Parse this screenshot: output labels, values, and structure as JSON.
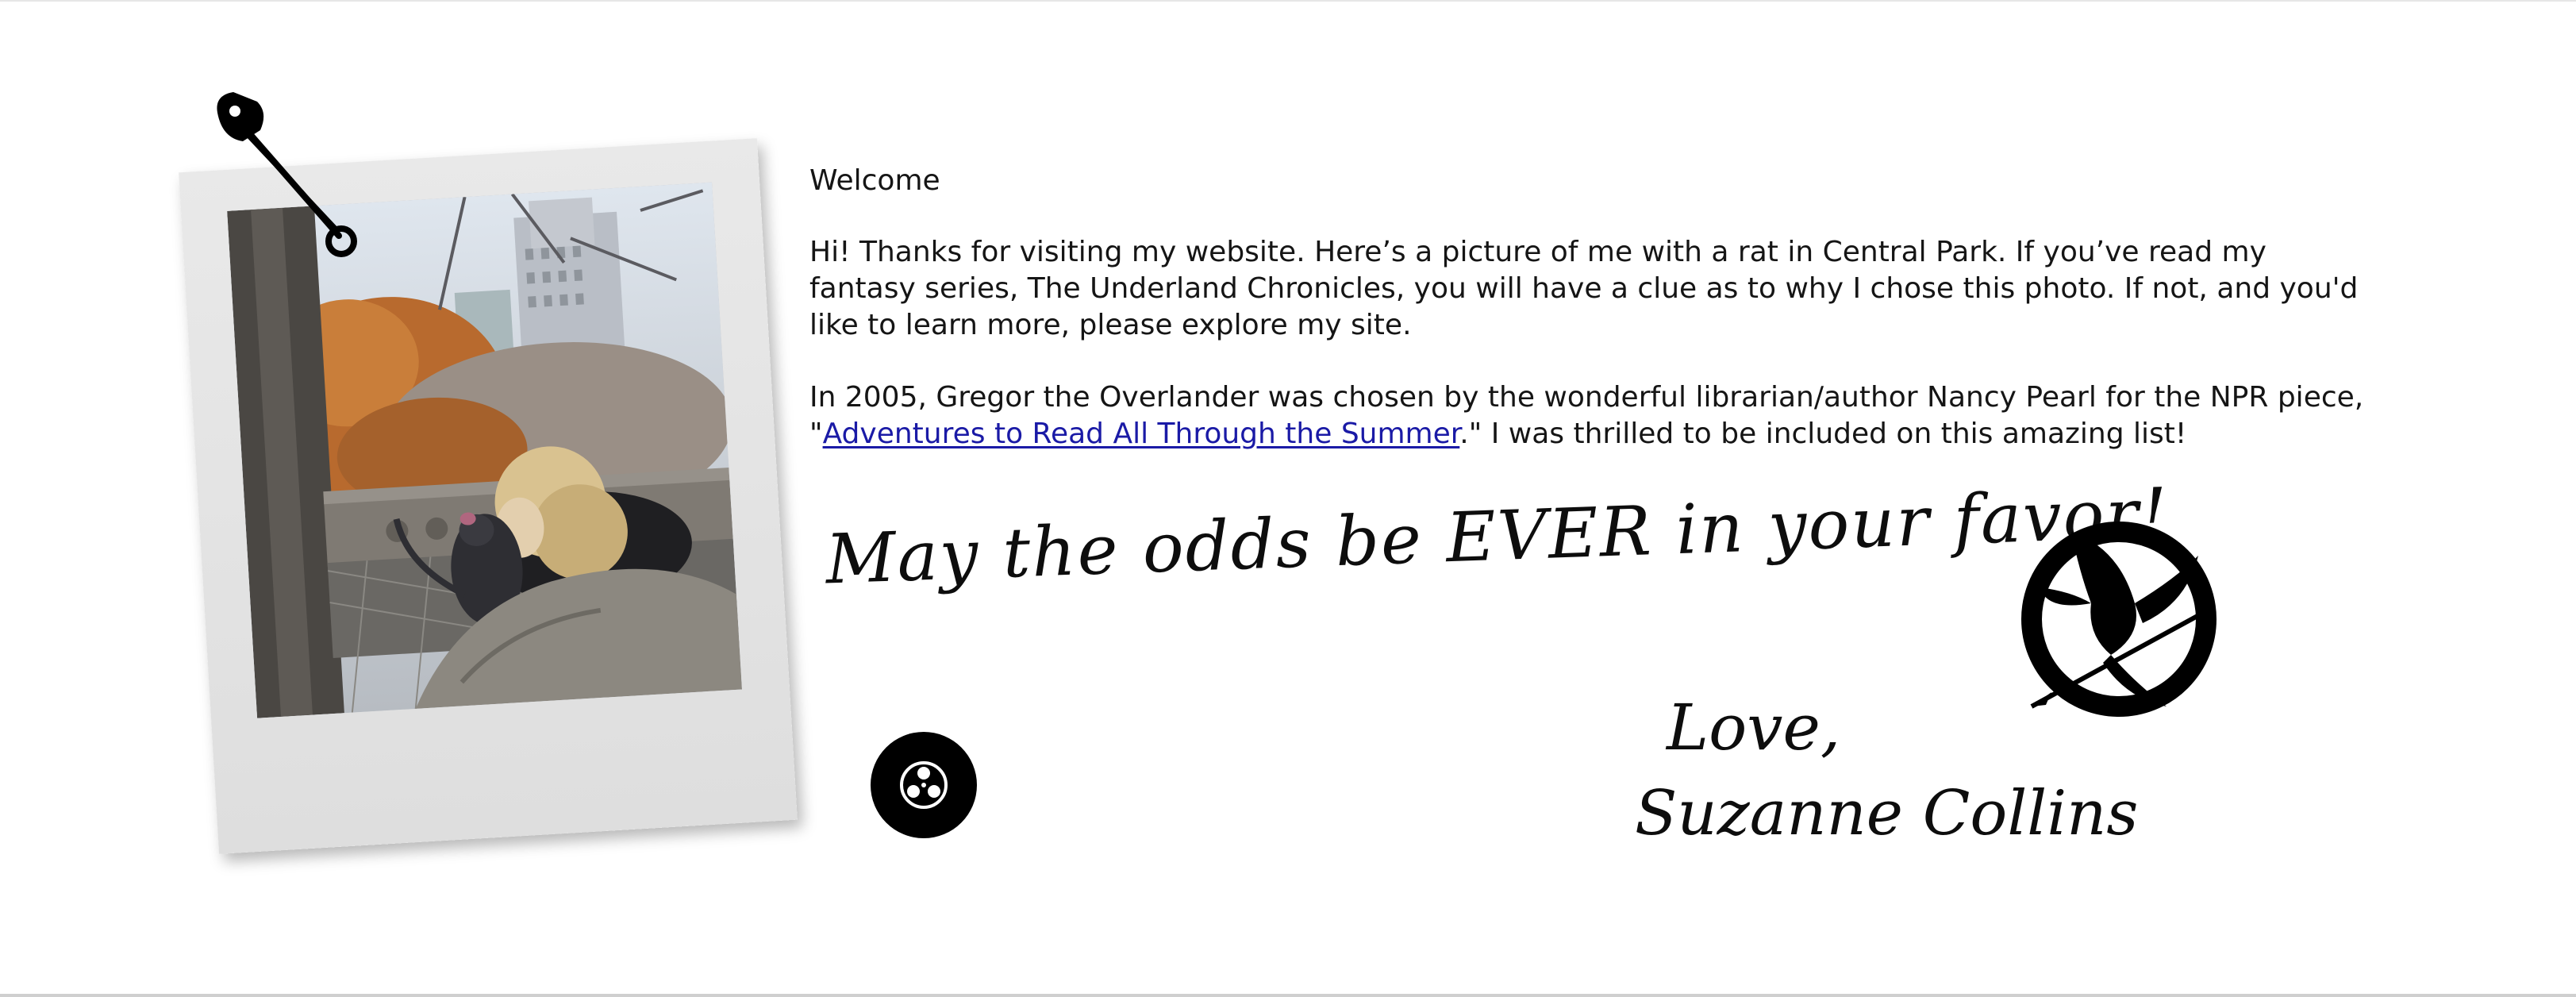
{
  "intro": {
    "heading": "Welcome",
    "paragraph1": "Hi! Thanks for visiting my website. Here’s a picture of me with a rat in Central Park. If you’ve read my fantasy series, The Underland Chronicles, you will have a clue as to why I chose this photo. If not, and you'd like to learn more, please explore my site.",
    "paragraph2_prefix": "In 2005, Gregor the Overlander was chosen by the wonderful librarian/author Nancy Pearl for the NPR piece, \"",
    "paragraph2_link": "Adventures to Read All Through the Summer",
    "paragraph2_suffix": ".\" I was thrilled to be included on this amazing list!"
  },
  "handwriting": {
    "motto": "May the odds be EVER in your favor!",
    "closing": "Love,",
    "signature": "Suzanne Collins"
  },
  "icons": {
    "pin": "safety-pin-icon",
    "emblem": "mockingjay-icon",
    "reel": "film-reel-icon"
  },
  "colors": {
    "link": "#1a1aa6",
    "text": "#151515",
    "polaroid": "#e3e3e3"
  }
}
